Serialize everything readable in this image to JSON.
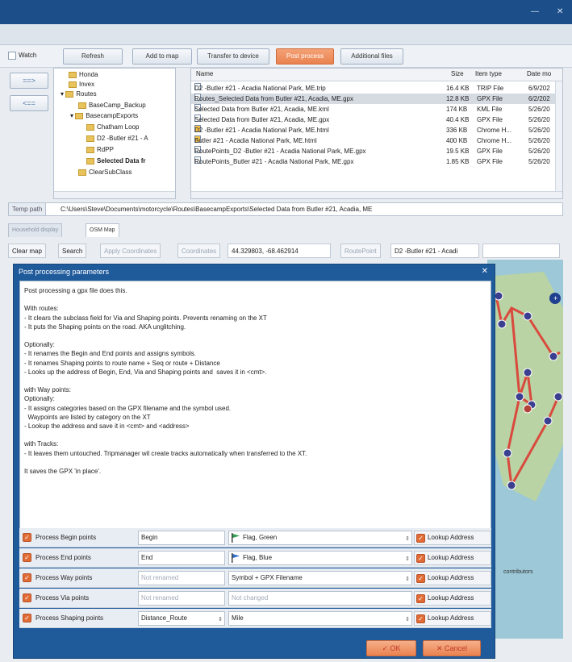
{
  "toolbar": {
    "watch_label": "Watch",
    "buttons": [
      "Refresh",
      "Add to map",
      "Transfer to device",
      "Post process",
      "Additional files"
    ]
  },
  "side_buttons": [
    "==>",
    "<=="
  ],
  "tree": {
    "items": [
      "Honda",
      "Invex",
      "Routes",
      "BaseCamp_Backup",
      "BasecampExports",
      "Chatham Loop",
      "D2 -Butler #21 - A",
      "RdPP",
      "Selected Data fr",
      "ClearSubClass"
    ]
  },
  "files": {
    "columns": [
      "Name",
      "Size",
      "Item type",
      "Date mo"
    ],
    "rows": [
      {
        "name": "D2 -Butler #21 - Acadia National Park, ME.trip",
        "size": "16.4 KB",
        "type": "TRIP File",
        "date": "6/9/202"
      },
      {
        "name": "Routes_Selected Data from Butler #21, Acadia, ME.gpx",
        "size": "12.8 KB",
        "type": "GPX File",
        "date": "6/2/202"
      },
      {
        "name": "Selected Data from Butler #21, Acadia, ME.kml",
        "size": "174 KB",
        "type": "KML File",
        "date": "5/26/20"
      },
      {
        "name": "Selected Data from Butler #21, Acadia, ME.gpx",
        "size": "40.4 KB",
        "type": "GPX File",
        "date": "5/26/20"
      },
      {
        "name": "D2 -Butler #21 - Acadia National Park, ME.html",
        "size": "336 KB",
        "type": "Chrome H...",
        "date": "5/26/20"
      },
      {
        "name": "Butler #21 - Acadia National Park, ME.html",
        "size": "400 KB",
        "type": "Chrome H...",
        "date": "5/26/20"
      },
      {
        "name": "RoutePoints_D2 -Butler #21 - Acadia National Park, ME.gpx",
        "size": "19.5 KB",
        "type": "GPX File",
        "date": "5/26/20"
      },
      {
        "name": "RoutePoints_Butler #21 - Acadia National Park, ME.gpx",
        "size": "1.85 KB",
        "type": "GPX File",
        "date": "5/26/20"
      }
    ]
  },
  "path": {
    "label": "Temp path",
    "value": "C:\\Users\\Steve\\Documents\\motorcycle\\Routes\\BasecampExports\\Selected Data from Butler #21, Acadia, ME"
  },
  "tabs": [
    "Household display",
    "OSM Map"
  ],
  "map_tools": {
    "clear_map": "Clear map",
    "search": "Search",
    "apply_coordinates": "Apply Coordinates",
    "coordinates_label": "Coordinates",
    "coordinates_value": "44.329803, -68.462914",
    "route_point_label": "RoutePoint",
    "route_point_value": "D2 -Butler #21 - Acadi"
  },
  "dialog": {
    "title": "Post processing parameters",
    "description": "Post processing a gpx file does this.\n\nWith routes:\n- It clears the subclass field for Via and Shaping points. Prevents renaming on the XT\n- It puts the Shaping points on the road. AKA unglitching.\n\nOptionally:\n- It renames the Begin and End points and assigns symbols.\n- It renames Shaping points to route name + Seq or route + Distance\n- Looks up the address of Begin, End, Via and Shaping points and  saves it in <cmt>.\n\nwith Way points:\nOptionally:\n- It assigns categories based on the GPX filename and the symbol used.\n  Waypoints are listed by category on the XT\n- Lookup the address and save it in <cmt> and <address>\n\nwith Tracks:\n- It leaves them untouched. Tripmanager wil create tracks automatically when transferred to the XT.\n\nIt saves the GPX 'in place'.",
    "rows": [
      {
        "label": "Process Begin points",
        "input": "Begin",
        "input_placeholder": false,
        "select": "Flag, Green",
        "select_placeholder": false,
        "flag_color": "#2e9e4f",
        "has_spin": true,
        "lookup": "Lookup Address"
      },
      {
        "label": "Process End points",
        "input": "End",
        "input_placeholder": false,
        "select": "Flag, Blue",
        "select_placeholder": false,
        "flag_color": "#2f6fc7",
        "has_spin": true,
        "lookup": "Lookup Address"
      },
      {
        "label": "Process Way points",
        "input": "Not renamed",
        "input_placeholder": true,
        "select": "Symbol + GPX Filename",
        "select_placeholder": false,
        "flag_color": "",
        "has_spin": true,
        "lookup": "Lookup Address"
      },
      {
        "label": "Process Via points",
        "input": "Not renamed",
        "input_placeholder": true,
        "select": "Not changed",
        "select_placeholder": true,
        "flag_color": "",
        "has_spin": false,
        "lookup": "Lookup Address"
      },
      {
        "label": "Process Shaping points",
        "input": "Distance_Route",
        "input_placeholder": false,
        "select": "Mile",
        "select_placeholder": false,
        "flag_color": "",
        "has_spin": true,
        "lookup": "Lookup Address"
      }
    ],
    "ok_label": "OK",
    "cancel_label": "Cancel"
  },
  "map_label": "contributors",
  "colors": {
    "title_bar": "#1c4f8a",
    "dialog_frame": "#1f5a9b",
    "accent_orange": "#ea8250",
    "route_red": "#d94a3d",
    "map_water": "#9cc8d8",
    "map_land": "#b9d3a5"
  }
}
